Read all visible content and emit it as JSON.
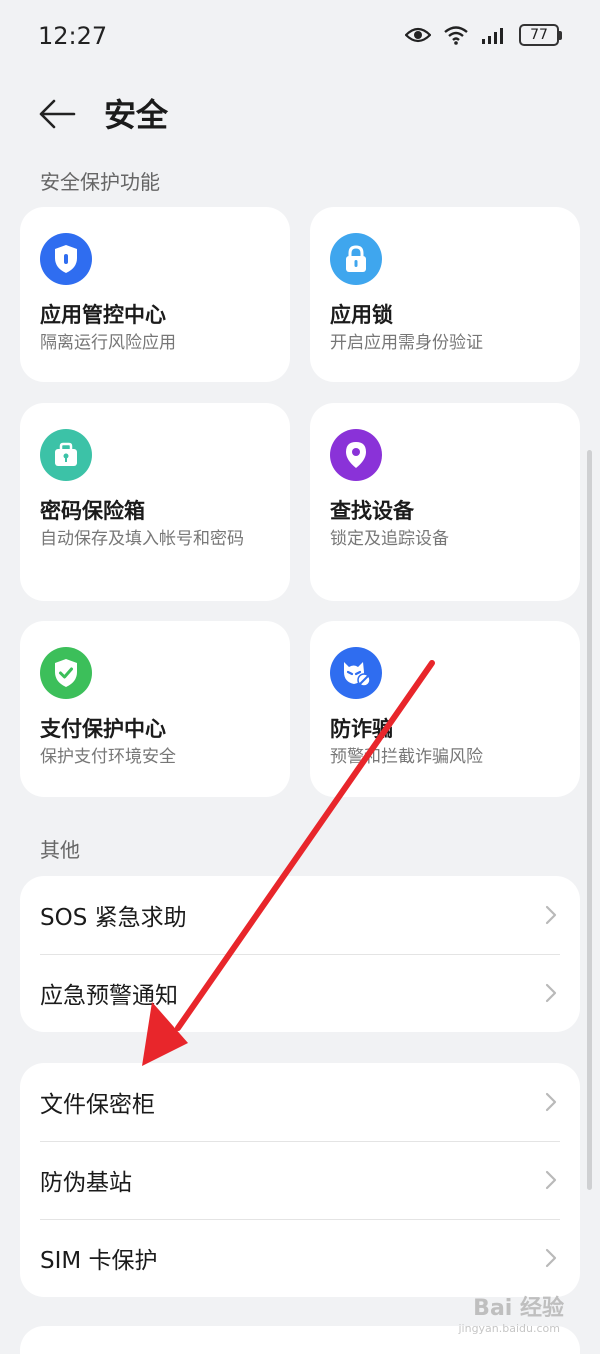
{
  "status": {
    "time": "12:27",
    "battery": "77"
  },
  "header": {
    "title": "安全"
  },
  "sections": {
    "protection_label": "安全保护功能",
    "other_label": "其他"
  },
  "cards": [
    {
      "title": "应用管控中心",
      "desc": "隔离运行风险应用",
      "icon": "shield-icon",
      "color": "#2f6df0"
    },
    {
      "title": "应用锁",
      "desc": "开启应用需身份验证",
      "icon": "lock-icon",
      "color": "#3fa6ee"
    },
    {
      "title": "密码保险箱",
      "desc": "自动保存及填入帐号和密码",
      "icon": "safe-box-icon",
      "color": "#3cc2a7"
    },
    {
      "title": "查找设备",
      "desc": "锁定及追踪设备",
      "icon": "location-pin-icon",
      "color": "#8a32d8"
    },
    {
      "title": "支付保护中心",
      "desc": "保护支付环境安全",
      "icon": "shield-check-icon",
      "color": "#3cbf5a"
    },
    {
      "title": "防诈骗",
      "desc": "预警和拦截诈骗风险",
      "icon": "anti-fraud-icon",
      "color": "#2f6df0"
    }
  ],
  "list_group_1": [
    {
      "label": "SOS 紧急求助"
    },
    {
      "label": "应急预警通知"
    }
  ],
  "list_group_2": [
    {
      "label": "文件保密柜"
    },
    {
      "label": "防伪基站"
    },
    {
      "label": "SIM 卡保护"
    }
  ],
  "watermark": {
    "text": "Bai 经验",
    "sub": "jingyan.baidu.com"
  },
  "annotation": {
    "arrow_color": "#e8262b"
  }
}
